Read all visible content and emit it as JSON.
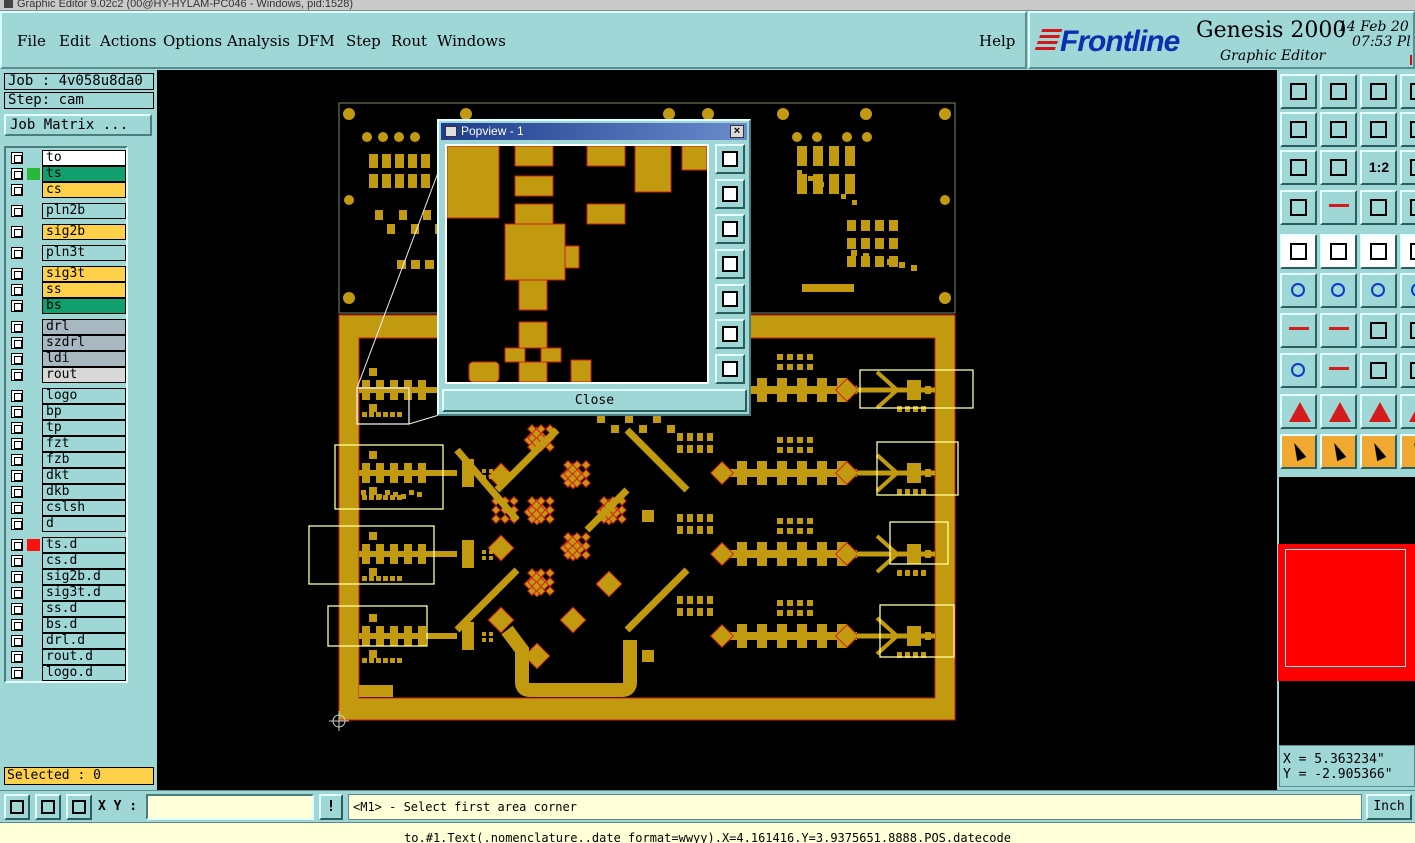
{
  "window": {
    "title": "Graphic Editor 9.02c2 (00@HY-HYLAM-PC046 - Windows, pid:1528)"
  },
  "menu": {
    "items": [
      "File",
      "Edit",
      "Actions",
      "Options",
      "Analysis",
      "DFM",
      "Step",
      "Rout",
      "Windows"
    ],
    "help": "Help"
  },
  "branding": {
    "logo": "Frontline",
    "product": "Genesis 2000",
    "subtitle": "Graphic Editor",
    "date": "14 Feb 20",
    "time": "07:53 Pl"
  },
  "job": {
    "job_line": "Job : 4v058u8da0",
    "step_line": "Step: cam",
    "matrix_button": "Job Matrix ..."
  },
  "layers": [
    {
      "name": "to",
      "color": "#ffffff",
      "swatch": ""
    },
    {
      "name": "ts",
      "color": "#10a070",
      "swatch": "#2bb83a"
    },
    {
      "name": "cs",
      "color": "#ffd04a",
      "swatch": ""
    },
    {
      "name": "pln2b",
      "color": "#9fd6d6",
      "swatch": ""
    },
    {
      "name": "sig2b",
      "color": "#ffd04a",
      "swatch": ""
    },
    {
      "name": "pln3t",
      "color": "#9fd6d6",
      "swatch": ""
    },
    {
      "name": "sig3t",
      "color": "#ffd04a",
      "swatch": ""
    },
    {
      "name": "ss",
      "color": "#ffd04a",
      "swatch": ""
    },
    {
      "name": "bs",
      "color": "#10a070",
      "swatch": ""
    },
    {
      "name": "drl",
      "color": "#a8b8c0",
      "swatch": ""
    },
    {
      "name": "szdrl",
      "color": "#a8b8c0",
      "swatch": ""
    },
    {
      "name": "ldi",
      "color": "#a8b8c0",
      "swatch": ""
    },
    {
      "name": "rout",
      "color": "#d8d8d8",
      "swatch": ""
    },
    {
      "name": "logo",
      "color": "#9fd6d6",
      "swatch": ""
    },
    {
      "name": "bp",
      "color": "#9fd6d6",
      "swatch": ""
    },
    {
      "name": "tp",
      "color": "#9fd6d6",
      "swatch": ""
    },
    {
      "name": "fzt",
      "color": "#9fd6d6",
      "swatch": ""
    },
    {
      "name": "fzb",
      "color": "#9fd6d6",
      "swatch": ""
    },
    {
      "name": "dkt",
      "color": "#9fd6d6",
      "swatch": ""
    },
    {
      "name": "dkb",
      "color": "#9fd6d6",
      "swatch": ""
    },
    {
      "name": "cslsh",
      "color": "#9fd6d6",
      "swatch": ""
    },
    {
      "name": "d",
      "color": "#9fd6d6",
      "swatch": ""
    },
    {
      "name": "ts.d",
      "color": "#9fd6d6",
      "swatch": "#ff1010"
    },
    {
      "name": "cs.d",
      "color": "#9fd6d6",
      "swatch": ""
    },
    {
      "name": "sig2b.d",
      "color": "#9fd6d6",
      "swatch": ""
    },
    {
      "name": "sig3t.d",
      "color": "#9fd6d6",
      "swatch": ""
    },
    {
      "name": "ss.d",
      "color": "#9fd6d6",
      "swatch": ""
    },
    {
      "name": "bs.d",
      "color": "#9fd6d6",
      "swatch": ""
    },
    {
      "name": "drl.d",
      "color": "#9fd6d6",
      "swatch": ""
    },
    {
      "name": "rout.d",
      "color": "#9fd6d6",
      "swatch": ""
    },
    {
      "name": "logo.d",
      "color": "#9fd6d6",
      "swatch": ""
    }
  ],
  "selected": "Selected : 0",
  "popview": {
    "title": "Popview - 1",
    "close_label": "Close"
  },
  "coords": {
    "x": "X = 5.363234\"",
    "y": "Y = -2.905366\""
  },
  "command": {
    "xy_label": "X Y :",
    "xy_value": "",
    "exclaim": "!",
    "prompt": "<M1> - Select first area corner",
    "unit": "Inch"
  },
  "status": "to.#1.Text(.nomenclature..date format=wwyy).X=4.161416.Y=3.9375651.8888.POS.datecode",
  "colors": {
    "copper": "#c29a10",
    "trace": "#d9a81e",
    "outline": "#d41c1c",
    "frame": "#ffff99"
  }
}
